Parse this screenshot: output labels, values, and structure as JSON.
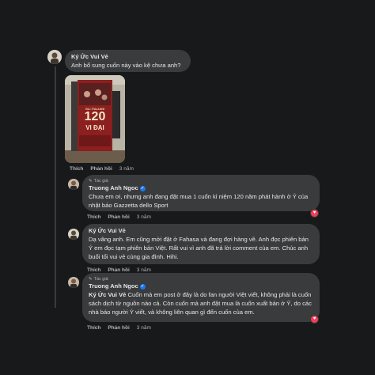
{
  "comments": [
    {
      "author": "Ký Ức Vui Vẻ",
      "text": "Anh bổ sung cuốn này vào kệ chưa anh?",
      "actions": [
        "Thích",
        "Phản hồi"
      ],
      "time": "3 năm"
    },
    {
      "badge": "Tác giả",
      "author": "Truong Anh Ngoc",
      "text": "Chưa em ơi, nhưng anh đang đặt mua 1 cuốn kỉ niệm 120 năm phát hành ở Ý của nhật báo Gazzetta dello Sport",
      "actions": [
        "Thích",
        "Phản hồi"
      ],
      "time": "3 năm",
      "reaction": "heart"
    },
    {
      "author": "Ký Ức Vui Vẻ",
      "text": "Dạ vâng anh. Em cũng mới đặt ở Fahasa và đang đợi hàng về. Anh đọc phiên bản Ý em đọc tạm phiên bản Việt. Rất vui vì anh đã trả lời comment của em. Chúc anh buổi tối vui vẻ cùng gia đình. Hihi.",
      "actions": [
        "Thích",
        "Phản hồi"
      ],
      "time": "3 năm"
    },
    {
      "badge": "Tác giả",
      "author": "Truong Anh Ngoc",
      "mention": "Ký Ức Vui Vẻ",
      "text": "Cuốn mà em post ở đây là do fan người Việt viết, không phải là cuốn sách dịch từ nguồn nào cả. Còn cuốn mà anh đặt mua là cuốn xuất bản ở Ý, do các nhà báo người Ý viết, và không liên quan gì đến cuốn của em.",
      "actions": [
        "Thích",
        "Phản hồi"
      ],
      "time": "3 năm",
      "reaction": "heart"
    }
  ],
  "book_cover": {
    "line1": "GLI ITALIANI",
    "line2": "120",
    "line3": "VI ĐẠI"
  },
  "colors": {
    "background": "#18191a",
    "bubble": "#3a3b3c",
    "reaction": "#f33e58",
    "verified": "#1877f2"
  }
}
